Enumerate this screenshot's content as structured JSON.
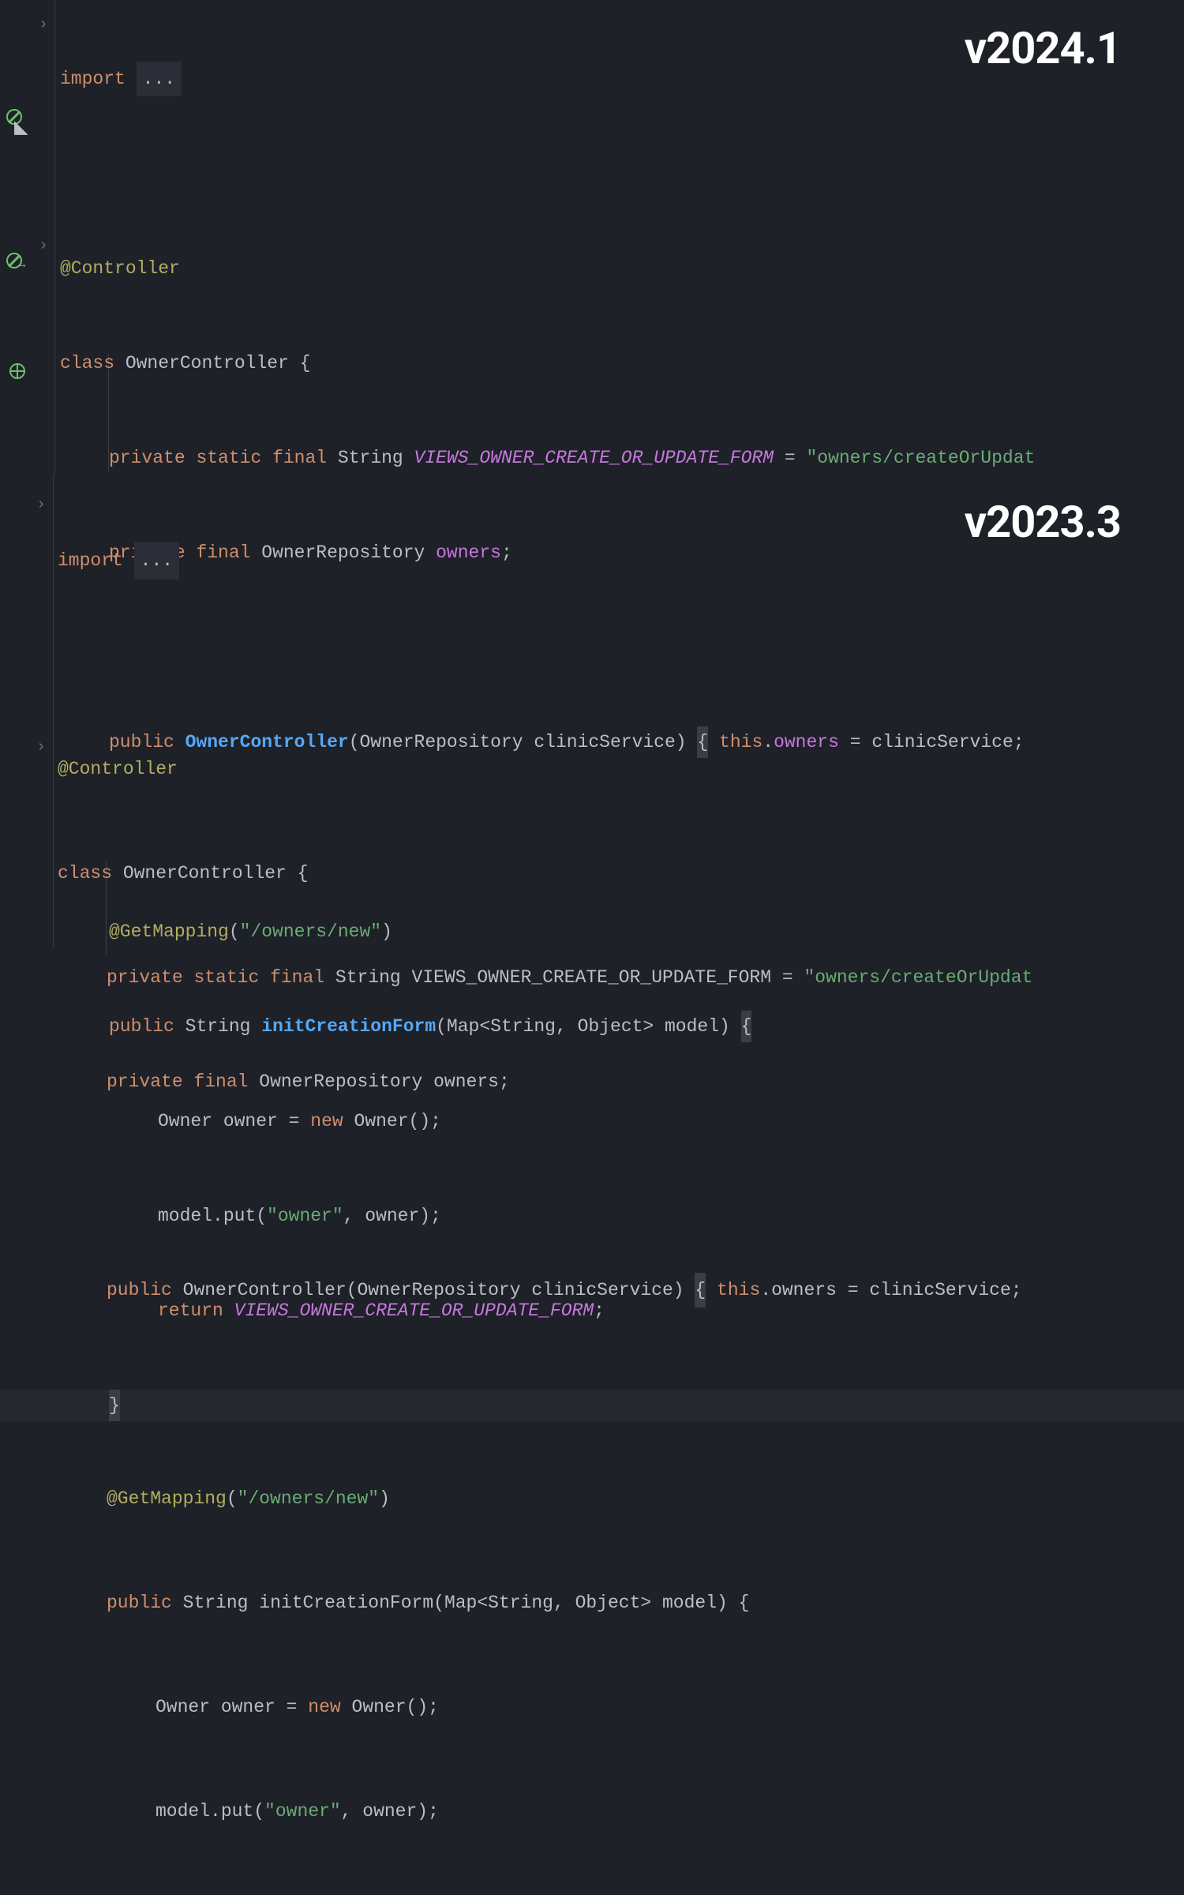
{
  "version_top": "v2024.1",
  "version_bottom": "v2023.3",
  "tokens": {
    "import": "import",
    "ellipsis": "...",
    "controller": "@Controller",
    "class": "class",
    "owner_controller": "OwnerController",
    "lbrace": "{",
    "rbrace": "}",
    "private": "private",
    "static": "static",
    "final": "final",
    "string_t": "String",
    "const_name": "VIEWS_OWNER_CREATE_OR_UPDATE_FORM",
    "eq": "=",
    "str_form": "\"owners/createOrUpdat",
    "owner_repo": "OwnerRepository",
    "owners_field": "owners",
    "semi": ";",
    "public": "public",
    "clinic": "clinicService",
    "lparen": "(",
    "rparen": ")",
    "this": "this",
    "dot": ".",
    "assign_clinic": " = clinicService;",
    "getmapping": "@GetMapping",
    "str_new": "\"/owners/new\"",
    "method_name": "initCreationForm",
    "map_sig": "Map<String, Object> model",
    "owner": "Owner",
    "owner_var": "owner",
    "new": "new",
    "owner_ctor": "Owner()",
    "model_put": "model.put(",
    "str_owner": "\"owner\"",
    "comma_owner": ", owner);",
    "return": "return"
  }
}
